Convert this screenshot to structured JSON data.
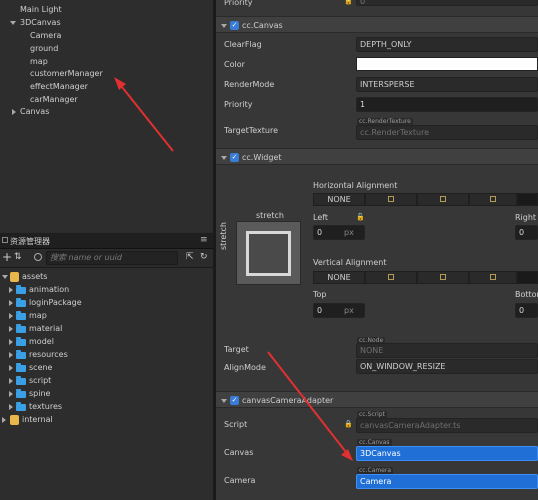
{
  "hierarchy": {
    "items": [
      {
        "label": "Main Light"
      },
      {
        "label": "3DCanvas"
      },
      {
        "label": "Camera"
      },
      {
        "label": "ground"
      },
      {
        "label": "map"
      },
      {
        "label": "customerManager"
      },
      {
        "label": "effectManager"
      },
      {
        "label": "carManager"
      },
      {
        "label": "Canvas"
      }
    ]
  },
  "assets_panel": {
    "title": "资源管理器",
    "menu_icon": "≡",
    "search_placeholder": "搜索 name or uuid",
    "items": [
      {
        "label": "assets",
        "icon": "database-icon"
      },
      {
        "label": "animation",
        "icon": "folder-icon"
      },
      {
        "label": "loginPackage",
        "icon": "folder-icon"
      },
      {
        "label": "map",
        "icon": "folder-icon"
      },
      {
        "label": "material",
        "icon": "folder-icon"
      },
      {
        "label": "model",
        "icon": "folder-icon"
      },
      {
        "label": "resources",
        "icon": "folder-icon"
      },
      {
        "label": "scene",
        "icon": "folder-icon"
      },
      {
        "label": "script",
        "icon": "folder-icon"
      },
      {
        "label": "spine",
        "icon": "folder-icon"
      },
      {
        "label": "textures",
        "icon": "folder-icon"
      },
      {
        "label": "internal",
        "icon": "database-icon"
      }
    ]
  },
  "inspector": {
    "top_row": {
      "label": "Priority",
      "value": "0"
    },
    "canvas_component": {
      "title": "cc.Canvas",
      "clear_flag": {
        "label": "ClearFlag",
        "value": "DEPTH_ONLY"
      },
      "color": {
        "label": "Color",
        "value": "#ffffff"
      },
      "render_mode": {
        "label": "RenderMode",
        "value": "INTERSPERSE"
      },
      "priority": {
        "label": "Priority",
        "value": "1"
      },
      "target_texture": {
        "label": "TargetTexture",
        "tag": "cc.RenderTexture",
        "value": "cc.RenderTexture"
      }
    },
    "widget_component": {
      "title": "cc.Widget",
      "stretch_h": "stretch",
      "stretch_v": "stretch",
      "horizontal_alignment": "Horizontal Alignment",
      "vertical_alignment": "Vertical Alignment",
      "none_label": "NONE",
      "left": {
        "label": "Left",
        "value": "0",
        "unit": "px"
      },
      "right": {
        "label": "Right",
        "value": "0"
      },
      "top": {
        "label": "Top",
        "value": "0",
        "unit": "px"
      },
      "bottom": {
        "label": "Bottom",
        "value": "0"
      },
      "target": {
        "label": "Target",
        "tag": "cc.Node",
        "value": "NONE"
      },
      "align_mode": {
        "label": "AlignMode",
        "value": "ON_WINDOW_RESIZE"
      }
    },
    "adapter_component": {
      "title": "canvasCameraAdapter",
      "script": {
        "label": "Script",
        "tag": "cc.Script",
        "value": "canvasCameraAdapter.ts"
      },
      "canvas": {
        "label": "Canvas",
        "tag": "cc.Canvas",
        "value": "3DCanvas"
      },
      "camera": {
        "label": "Camera",
        "tag": "cc.Camera",
        "value": "Camera"
      }
    }
  },
  "colors": {
    "accent": "#1f6fd6",
    "folder": "#3b9fe5",
    "annotation_arrow": "#e03030"
  }
}
